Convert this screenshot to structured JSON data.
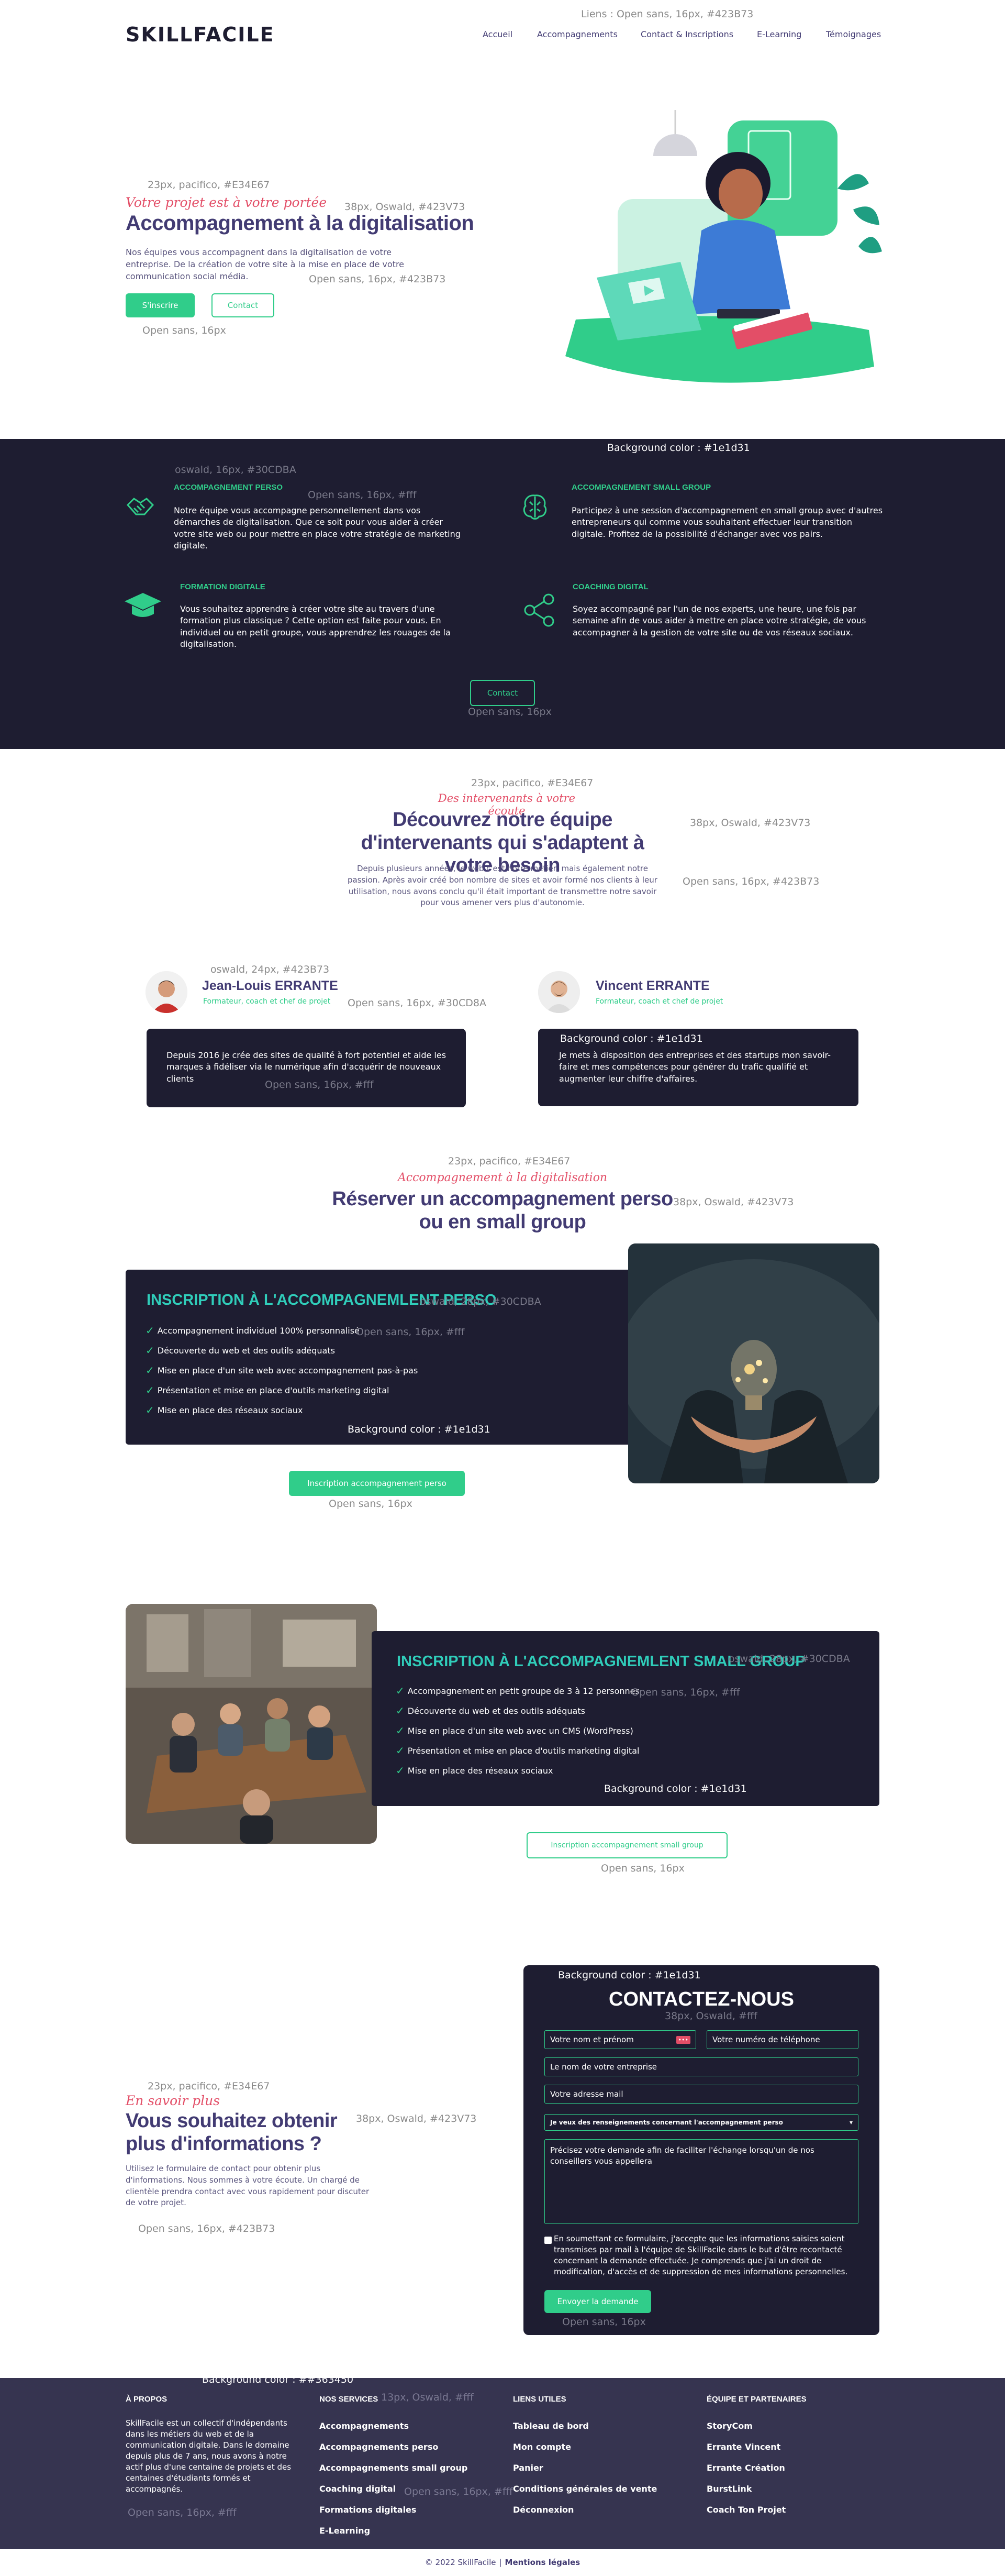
{
  "header": {
    "logo": "SKILLFACILE",
    "annotation": "Liens : Open sans, 16px, #423B73",
    "nav": [
      "Accueil",
      "Accompagnements",
      "Contact & Inscriptions",
      "E-Learning",
      "Témoignages"
    ]
  },
  "hero": {
    "anno_script": "23px, pacifico, #E34E67",
    "script": "Votre projet est à votre portée",
    "anno_title": "38px, Oswald, #423V73",
    "title": "Accompagnement à la digitalisation",
    "text": "Nos équipes vous accompagnent dans la digitalisation de votre entreprise. De la création de votre site à la mise en place de votre communication social média.",
    "anno_text": "Open sans, 16px, #423B73",
    "btn_primary": "S'inscrire",
    "btn_secondary": "Contact",
    "anno_btn": "Open sans, 16px"
  },
  "services": {
    "anno_bg": "Background color : #1e1d31",
    "anno_title": "oswald, 16px,  #30CDBA",
    "anno_text": "Open sans, 16px, #fff",
    "items": [
      {
        "title": "Accompagnement perso",
        "icon": "handshake-icon",
        "text": "Notre équipe vous accompagne personnellement dans vos démarches de digitalisation. Que ce soit pour vous aider à créer votre site web ou pour mettre en place votre stratégie de marketing digitale."
      },
      {
        "title": "Accompagnement small group",
        "icon": "brain-icon",
        "text": "Participez à une session d'accompagnement en small group avec d'autres entrepreneurs qui comme vous souhaitent effectuer leur transition digitale. Profitez de la possibilité d'échanger avec vos pairs."
      },
      {
        "title": "Formation digitale",
        "icon": "graduation-cap-icon",
        "text": "Vous souhaitez apprendre à créer votre site au travers d'une formation plus classique ? Cette option est faite pour vous. En individuel ou en petit groupe, vous apprendrez les rouages de la digitalisation."
      },
      {
        "title": "Coaching digital",
        "icon": "share-icon",
        "text": "Soyez accompagné par l'un de nos experts, une heure, une fois par semaine afin de vous aider à mettre en place votre stratégie, de vous accompagner à la gestion de votre site ou de vos réseaux sociaux."
      }
    ],
    "btn": "Contact",
    "anno_btn": "Open sans, 16px"
  },
  "team": {
    "anno_script": "23px, pacifico, #E34E67",
    "script": "Des intervenants à votre écoute",
    "title": "Découvrez notre équipe d'intervenants qui s'adaptent à votre besoin",
    "anno_title": "38px, Oswald, #423V73",
    "text": "Depuis plusieurs années, le web c'est notre métier, mais également notre passion. Après avoir créé bon nombre de sites et avoir formé nos clients à leur utilisation, nous avons conclu qu'il était important de transmettre notre savoir pour vous amener vers plus d'autonomie.",
    "anno_text": "Open sans, 16px, #423B73",
    "anno_name": "oswald, 24px,  #423B73",
    "anno_role": "Open sans, 16px, #30CD8A",
    "anno_bg": "Background color : #1e1d31",
    "anno_card_text": "Open sans, 16px, #fff",
    "members": [
      {
        "name": "Jean-Louis ERRANTE",
        "role": "Formateur, coach et chef de projet",
        "bio": "Depuis 2016 je crée des sites de qualité à fort potentiel et aide les marques à fidéliser via le numérique afin d'acquérir de nouveaux clients"
      },
      {
        "name": "Vincent ERRANTE",
        "role": "Formateur, coach et chef de projet",
        "bio": "Je mets à disposition des entreprises et des startups mon savoir-faire et mes compétences pour générer du trafic qualifié et augmenter leur chiffre d'affaires."
      }
    ]
  },
  "booking": {
    "anno_script": "23px, pacifico, #E34E67",
    "script": "Accompagnement à la digitalisation",
    "title": "Réserver un accompagnement perso ou en small group",
    "anno_title": "38px, Oswald, #423V73"
  },
  "offer_perso": {
    "title": "INSCRIPTION À L'ACCOMPAGNEMLENT PERSO",
    "anno_title": "oswald, 28px,  #30CDBA",
    "anno_items": "Open sans, 16px, #fff",
    "anno_bg": "Background color : #1e1d31",
    "items": [
      "Accompagnement individuel 100% personnalisé",
      "Découverte du web et des outils adéquats",
      "Mise en place d'un site web avec accompagnement pas-à-pas",
      "Présentation et mise en place d'outils marketing digital",
      "Mise en place des réseaux sociaux"
    ],
    "btn": "Inscription accompagnement perso",
    "anno_btn": "Open sans, 16px"
  },
  "offer_group": {
    "title": "INSCRIPTION À L'ACCOMPAGNEMLENT SMALL GROUP",
    "anno_title": "oswald, 28px,  #30CDBA",
    "anno_items": "Open sans, 16px, #fff",
    "anno_bg": "Background color : #1e1d31",
    "items": [
      "Accompagnement en petit groupe de 3 à 12 personnes",
      "Découverte du web et des outils adéquats",
      "Mise en place d'un site web avec un CMS (WordPress)",
      "Présentation et mise en place d'outils marketing digital",
      "Mise en place des réseaux sociaux"
    ],
    "btn": "Inscription accompagnement small group",
    "anno_btn": "Open sans, 16px"
  },
  "contact": {
    "anno_script": "23px, pacifico, #E34E67",
    "script": "En savoir plus",
    "title": "Vous souhaitez obtenir plus d'informations ?",
    "anno_title": "38px, Oswald, #423V73",
    "text": "Utilisez le formulaire de contact pour obtenir plus d'informations. Nous sommes à votre écoute. Un chargé de clientèle prendra contact avec vous rapidement pour discuter de votre projet.",
    "anno_text": "Open sans, 16px, #423B73",
    "form": {
      "anno_bg": "Background color : #1e1d31",
      "title": "CONTACTEZ-NOUS",
      "anno_title": "38px, Oswald, #fff",
      "name": "Votre nom et prénom",
      "phone": "Votre numéro de téléphone",
      "company": "Le nom de votre entreprise",
      "email": "Votre adresse mail",
      "select": "Je veux des renseignements concernant l'accompagnement perso",
      "message": "Précisez votre demande afin de faciliter l'échange lorsqu'un de nos conseillers vous appellera",
      "consent": "En soumettant ce formulaire, j'accepte que les informations saisies soient transmises par mail à l'équipe de SkillFacile dans le but d'être recontacté concernant la demande effectuée. Je comprends que j'ai un droit de modification, d'accès et de suppression de mes informations personnelles.",
      "submit": "Envoyer la demande",
      "anno_submit": "Open sans, 16px"
    }
  },
  "footer": {
    "anno_bg": "Background color : ##363450",
    "anno_title": "13px, Oswald, #fff",
    "anno_text": "Open sans, 16px, #fff",
    "anno_links": "Open sans, 16px, #fff",
    "about_title": "À PROPOS",
    "about_text": "SkillFacile est un collectif d'indépendants dans les métiers du web et de la communication digitale. Dans le domaine depuis plus de 7 ans, nous avons à notre actif plus d'une centaine de projets et des centaines d'étudiants formés et accompagnés.",
    "services_title": "NOS SERVICES",
    "services": [
      "Accompagnements",
      "Accompagnements perso",
      "Accompagnements small group",
      "Coaching digital",
      "Formations digitales",
      "E-Learning"
    ],
    "links_title": "LIENS UTILES",
    "links": [
      "Tableau de bord",
      "Mon compte",
      "Panier",
      "Conditions générales de vente",
      "Déconnexion"
    ],
    "partners_title": "ÉQUIPE ET PARTENAIRES",
    "partners": [
      "StoryCom",
      "Errante Vincent",
      "Errante Création",
      "BurstLink",
      "Coach Ton Projet"
    ],
    "copyright": "© 2022 SkillFacile",
    "legal": "Mentions légales"
  }
}
